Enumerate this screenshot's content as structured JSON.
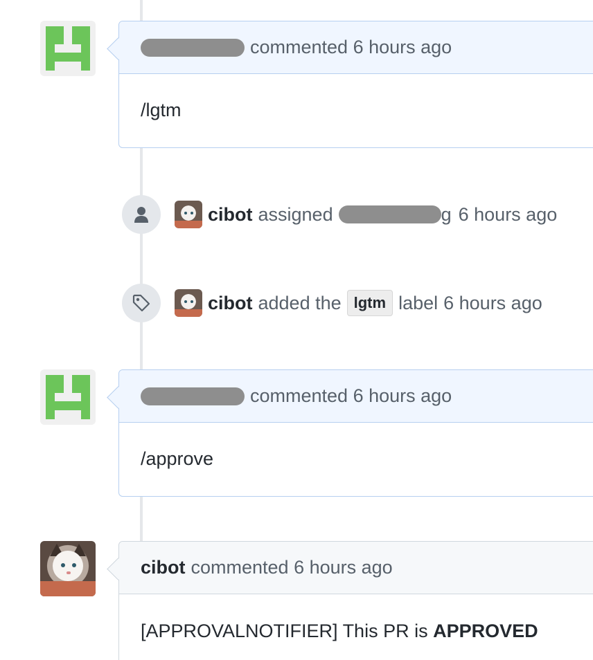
{
  "comments": [
    {
      "verb": "commented",
      "time": "6 hours ago",
      "body": "/lgtm"
    },
    {
      "verb": "commented",
      "time": "6 hours ago",
      "body": "/approve"
    },
    {
      "author": "cibot",
      "verb": "commented",
      "time": "6 hours ago",
      "body_prefix": "[APPROVALNOTIFIER] This PR is ",
      "body_strong": "APPROVED"
    }
  ],
  "events": [
    {
      "actor": "cibot",
      "action": "assigned",
      "assignee_suffix": "g",
      "time": "6 hours ago",
      "icon": "person-icon"
    },
    {
      "actor": "cibot",
      "action": "added the",
      "label": "lgtm",
      "after_label": "label",
      "time": "6 hours ago",
      "icon": "tag-icon"
    }
  ],
  "colors": {
    "identicon_green": "#6cc55a",
    "redaction_gray": "#8e8e8e",
    "header_blue": "#f0f6ff"
  }
}
